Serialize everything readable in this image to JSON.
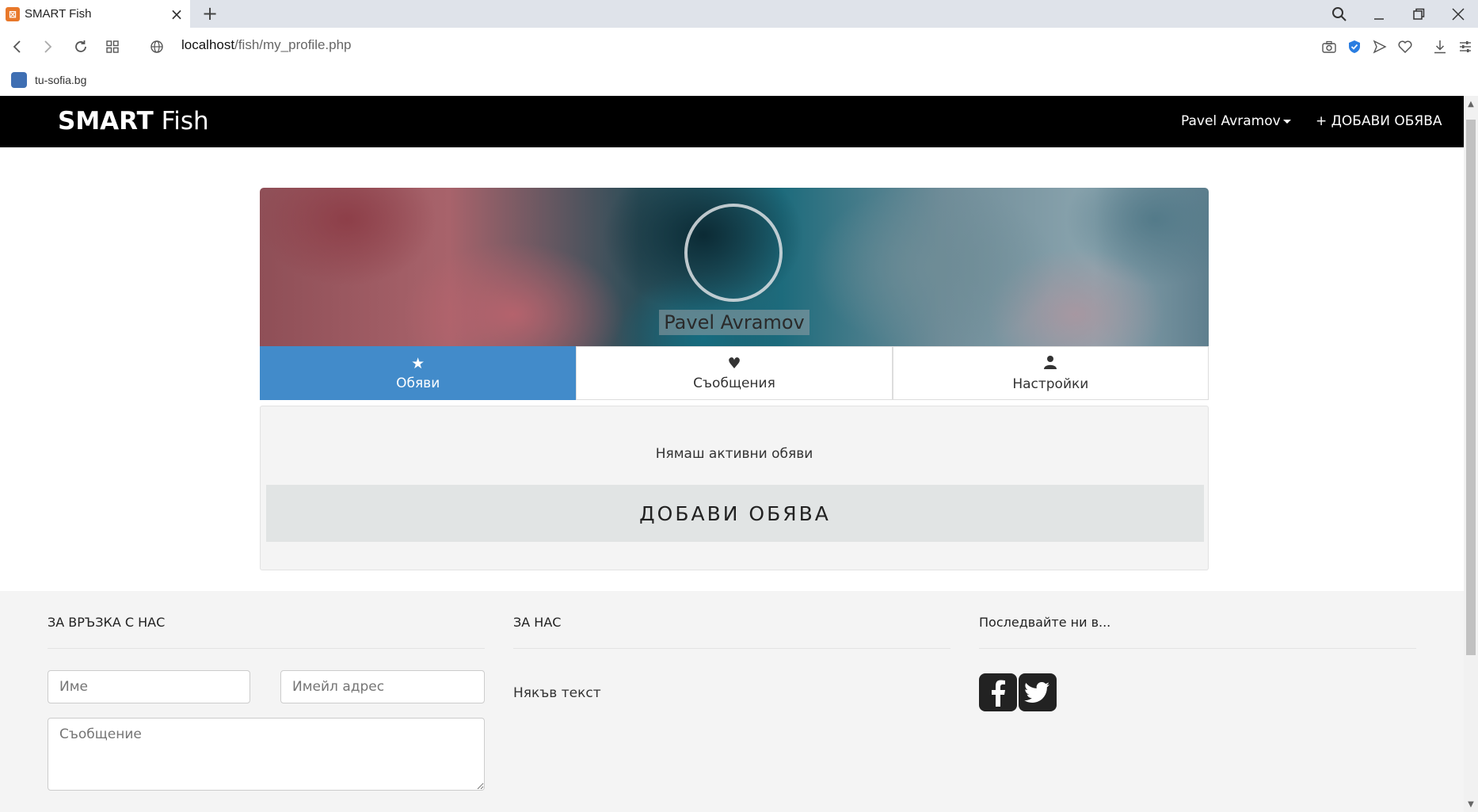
{
  "browser": {
    "tab_title": "SMART Fish",
    "url_host": "localhost",
    "url_path": "/fish/my_profile.php",
    "bookmark": "tu-sofia.bg"
  },
  "navbar": {
    "brand_bold": "SMART",
    "brand_rest": " Fish",
    "user_name": "Pavel Avramov",
    "add_ad": "+ ДОБАВИ ОБЯВА"
  },
  "profile": {
    "name": "Pavel Avramov",
    "tabs": [
      {
        "label": "Обяви",
        "icon": "star-icon",
        "active": true
      },
      {
        "label": "Съобщения",
        "icon": "heart-icon",
        "active": false
      },
      {
        "label": "Настройки",
        "icon": "user-icon",
        "active": false
      }
    ],
    "no_ads_text": "Нямаш активни обяви",
    "add_ad_button": "ДОБАВИ ОБЯВА"
  },
  "footer": {
    "contact_title": "ЗА ВРЪЗКА С НАС",
    "name_placeholder": "Име",
    "email_placeholder": "Имейл адрес",
    "message_placeholder": "Съобщение",
    "about_title": "ЗА НАС",
    "about_text": "Някъв текст",
    "follow_title": "Последвайте ни в..."
  },
  "colors": {
    "navbar_bg": "#000000",
    "tab_active": "#428bca",
    "footer_bg": "#f4f4f4"
  }
}
